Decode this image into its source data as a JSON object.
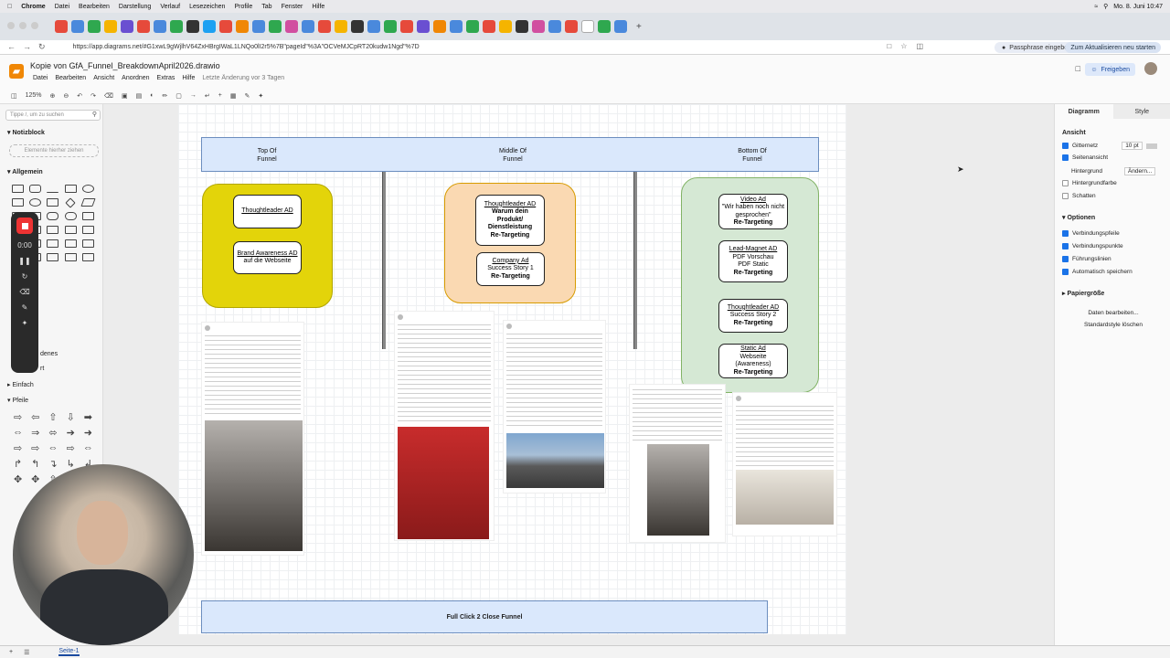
{
  "mac_menubar": {
    "app": "Chrome",
    "items": [
      "Datei",
      "Bearbeiten",
      "Darstellung",
      "Verlauf",
      "Lesezeichen",
      "Profile",
      "Tab",
      "Fenster",
      "Hilfe"
    ],
    "datetime": "Mo. 8. Juni 10:47"
  },
  "browser": {
    "url": "https://app.diagrams.net/#G1xwL9gWjlhV64ZxHBrgIWaL1LNQo0lI2r5%7B\"pageId\"%3A\"OCVeMJCpRT20kudw1Ngd\"%7D",
    "passphrase_label": "Passphrase eingeben",
    "update_label": "Zum Aktualisieren neu starten"
  },
  "app": {
    "title": "Kopie von GfA_Funnel_BreakdownApril2026.drawio",
    "menu": [
      "Datei",
      "Bearbeiten",
      "Ansicht",
      "Anordnen",
      "Extras",
      "Hilfe"
    ],
    "last_change": "Letzte Änderung vor 3 Tagen",
    "share_label": "Freigeben",
    "zoom": "125%"
  },
  "left_panel": {
    "search_placeholder": "Tippe /, um zu suchen",
    "sections": {
      "notepad": "Notizblock",
      "drop_hint": "Elemente hierher ziehen",
      "general": "Allgemein",
      "misc_partial": "denes",
      "misc2_partial": "rt",
      "simple": "Einfach",
      "arrows": "Pfeile"
    }
  },
  "recorder": {
    "time": "0:00"
  },
  "diagram": {
    "columns": [
      {
        "line1": "Top Of",
        "line2": "Funnel"
      },
      {
        "line1": "Middle Of",
        "line2": "Funnel"
      },
      {
        "line1": "Bottom Of",
        "line2": "Funnel"
      }
    ],
    "top_cards": [
      {
        "title": "Thoughtleader AD",
        "sub": ""
      },
      {
        "title": "Brand Awareness AD",
        "sub": "auf die Webseite"
      }
    ],
    "middle_cards": [
      {
        "title": "Thoughtleader AD",
        "l2": "Warum dein",
        "l3": "Produkt/",
        "l4": "Dienstleistung",
        "l5": "Re-Targeting"
      },
      {
        "title": "Company Ad",
        "l2": "Success Story 1",
        "l3": "Re-Targeting"
      }
    ],
    "bottom_cards": [
      {
        "title": "Video Ad",
        "l2": "\"Wir haben noch nicht",
        "l3": "gesprochen\"",
        "l4": "Re-Targeting"
      },
      {
        "title": "Lead-Magnet AD",
        "l2": "PDF Vorschau",
        "l3": "PDF Static",
        "l4": "Re-Targeting"
      },
      {
        "title": "Thoughtleader AD",
        "l2": "Success Story 2",
        "l3": "Re-Targeting"
      },
      {
        "title": "Static Ad",
        "l2": "Webseite",
        "l3": "(Awareness)",
        "l4": "Re-Targeting"
      }
    ],
    "bottom_band": "Full Click 2 Close Funnel",
    "colors": {
      "header_fill": "#dae8fc",
      "top_fill": "#e3d40a",
      "middle_fill": "#fad9b2",
      "bottom_fill": "#d5e8d4"
    }
  },
  "right_panel": {
    "tabs": [
      "Diagramm",
      "Style"
    ],
    "view_heading": "Ansicht",
    "grid_label": "Gitternetz",
    "grid_size": "10 pt",
    "page_view": "Seitenansicht",
    "background": "Hintergrund",
    "change": "Ändern...",
    "bg_color": "Hintergrundfarbe",
    "shadow": "Schatten",
    "options_heading": "Optionen",
    "opt1": "Verbindungspfeile",
    "opt2": "Verbindungspunkte",
    "opt3": "Führungslinien",
    "opt4": "Automatisch speichern",
    "paper_size": "Papiergröße",
    "edit_data": "Daten bearbeiten...",
    "clear_style": "Standardstyle löschen"
  },
  "status": {
    "page": "Seite-1"
  }
}
